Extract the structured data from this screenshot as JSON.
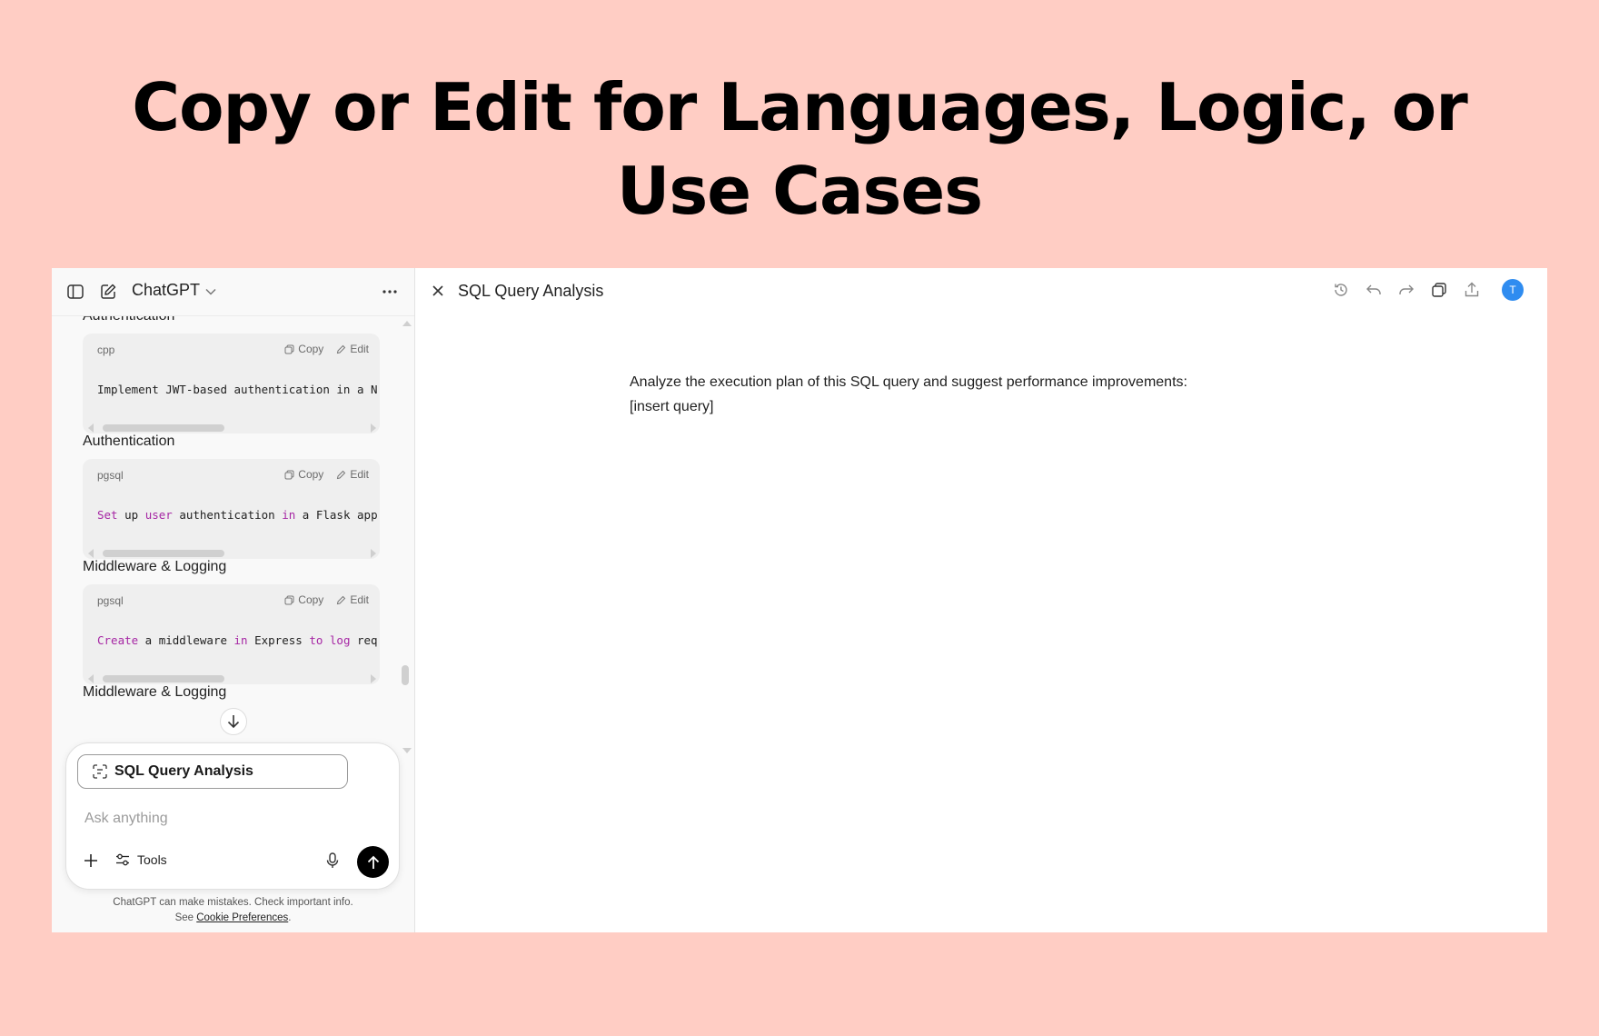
{
  "headline": {
    "line1": "Copy or Edit for Languages, Logic, or",
    "line2": "Use Cases"
  },
  "left_panel": {
    "app_title": "ChatGPT",
    "sections": [
      {
        "title": "Authentication",
        "code": {
          "lang": "cpp",
          "copy_label": "Copy",
          "edit_label": "Edit",
          "tokens": [
            {
              "t": "Implement JWT-based authentication in a N",
              "kw": false
            }
          ]
        }
      },
      {
        "title": "Authentication",
        "code": {
          "lang": "pgsql",
          "copy_label": "Copy",
          "edit_label": "Edit",
          "tokens": [
            {
              "t": "Set",
              "kw": true
            },
            {
              "t": " up ",
              "kw": false
            },
            {
              "t": "user",
              "kw": true
            },
            {
              "t": " authentication ",
              "kw": false
            },
            {
              "t": "in",
              "kw": true
            },
            {
              "t": " a Flask app",
              "kw": false
            }
          ]
        }
      },
      {
        "title": "Middleware & Logging",
        "code": {
          "lang": "pgsql",
          "copy_label": "Copy",
          "edit_label": "Edit",
          "tokens": [
            {
              "t": "Create",
              "kw": true
            },
            {
              "t": " a middleware ",
              "kw": false
            },
            {
              "t": "in",
              "kw": true
            },
            {
              "t": " Express ",
              "kw": false
            },
            {
              "t": "to",
              "kw": true
            },
            {
              "t": " ",
              "kw": false
            },
            {
              "t": "log",
              "kw": true
            },
            {
              "t": " req",
              "kw": false
            }
          ]
        }
      },
      {
        "title": "Middleware & Logging",
        "code": null
      }
    ],
    "composer": {
      "chip_label": "SQL Query Analysis",
      "placeholder": "Ask anything",
      "tools_label": "Tools"
    },
    "footer": {
      "line1": "ChatGPT can make mistakes. Check important info.",
      "see": "See",
      "link": "Cookie Preferences",
      "period": "."
    }
  },
  "right_panel": {
    "title": "SQL Query Analysis",
    "avatar_initial": "T",
    "content": {
      "line1": "Analyze the execution plan of this SQL query and suggest performance improvements:",
      "line2": "[insert query]"
    }
  },
  "colors": {
    "background": "#ffcdc4",
    "keyword": "#a626a4",
    "avatar": "#2f8cf0"
  }
}
